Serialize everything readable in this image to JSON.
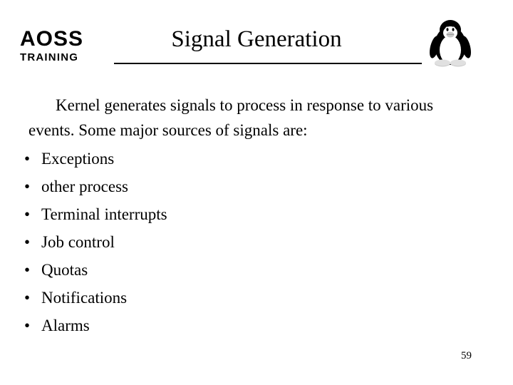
{
  "header": {
    "logo_main": "AOSS",
    "logo_sub": "TRAINING",
    "title": "Signal Generation",
    "mascot_icon": "linux-tux-penguin-icon"
  },
  "content": {
    "intro": "Kernel generates signals to process in response to various events. Some major sources of signals are:",
    "bullet_char": "•",
    "bullets": [
      "Exceptions",
      "other process",
      "Terminal interrupts",
      "Job control",
      "Quotas",
      "Notifications",
      "Alarms"
    ]
  },
  "footer": {
    "page_number": "59"
  },
  "colors": {
    "background": "#ffffff",
    "text": "#000000",
    "rule": "#000000"
  }
}
